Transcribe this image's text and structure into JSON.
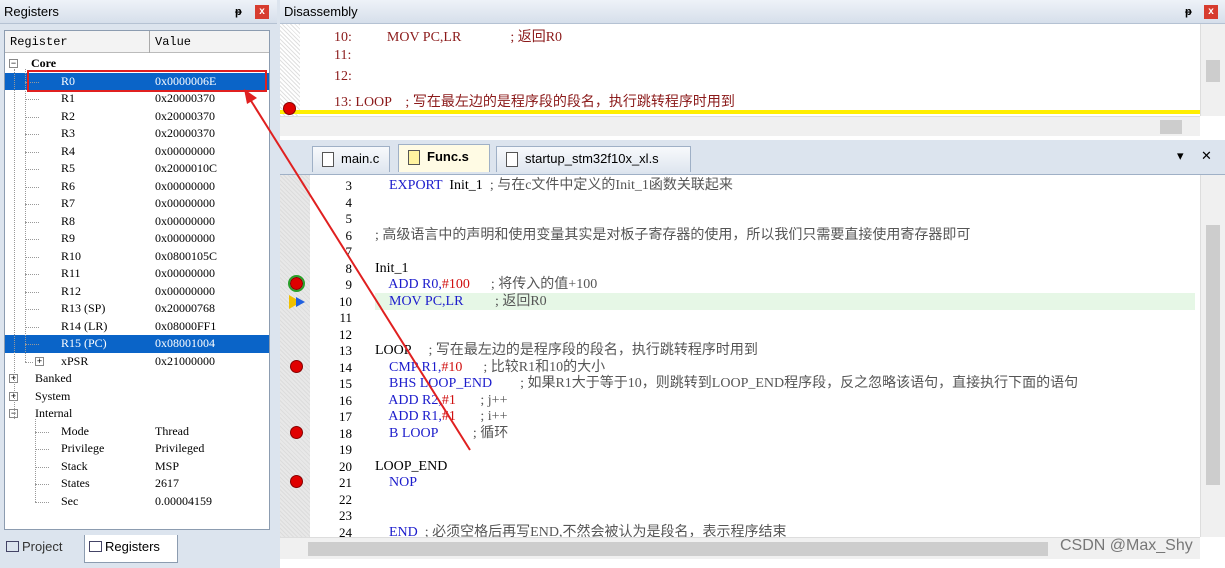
{
  "registers_panel": {
    "title": "Registers",
    "pin": "ᵽ",
    "close": "x",
    "col_register": "Register",
    "col_value": "Value",
    "groups": {
      "core": "Core",
      "banked": "Banked",
      "system": "System",
      "internal": "Internal"
    },
    "core_rows": [
      {
        "name": "R0",
        "value": "0x0000006E"
      },
      {
        "name": "R1",
        "value": "0x20000370"
      },
      {
        "name": "R2",
        "value": "0x20000370"
      },
      {
        "name": "R3",
        "value": "0x20000370"
      },
      {
        "name": "R4",
        "value": "0x00000000"
      },
      {
        "name": "R5",
        "value": "0x2000010C"
      },
      {
        "name": "R6",
        "value": "0x00000000"
      },
      {
        "name": "R7",
        "value": "0x00000000"
      },
      {
        "name": "R8",
        "value": "0x00000000"
      },
      {
        "name": "R9",
        "value": "0x00000000"
      },
      {
        "name": "R10",
        "value": "0x0800105C"
      },
      {
        "name": "R11",
        "value": "0x00000000"
      },
      {
        "name": "R12",
        "value": "0x00000000"
      },
      {
        "name": "R13 (SP)",
        "value": "0x20000768"
      },
      {
        "name": "R14 (LR)",
        "value": "0x08000FF1"
      },
      {
        "name": "R15 (PC)",
        "value": "0x08001004"
      },
      {
        "name": "xPSR",
        "value": "0x21000000"
      }
    ],
    "internal_rows": [
      {
        "name": "Mode",
        "value": "Thread"
      },
      {
        "name": "Privilege",
        "value": "Privileged"
      },
      {
        "name": "Stack",
        "value": "MSP"
      },
      {
        "name": "States",
        "value": "2617"
      },
      {
        "name": "Sec",
        "value": "0.00004159"
      }
    ],
    "tabs": {
      "project": "Project",
      "registers": "Registers"
    }
  },
  "disassembly": {
    "title": "Disassembly",
    "pin": "ᵽ",
    "close": "x",
    "lines": [
      "    10:          MOV PC,LR              ; 返回R0",
      "    11:",
      "    12:",
      "    13: LOOP    ; 写在最左边的是程序段的段名，执行跳转程序时用到"
    ]
  },
  "editor": {
    "tabs": [
      "main.c",
      "Func.s",
      "startup_stm32f10x_xl.s"
    ],
    "menu_glyph": "▾",
    "close_glyph": "✕",
    "lines": [
      {
        "n": "3",
        "code": [
          [
            "kw",
            "    EXPORT  "
          ],
          [
            "",
            "Init_1  "
          ],
          [
            "cm",
            "; 与在c文件中定义的Init_1函数关联起来"
          ]
        ]
      },
      {
        "n": "4",
        "code": []
      },
      {
        "n": "5",
        "code": []
      },
      {
        "n": "6",
        "code": [
          [
            "cm",
            "; 高级语言中的声明和使用变量其实是对板子寄存器的使用，所以我们只需要直接使用寄存器即可"
          ]
        ]
      },
      {
        "n": "7",
        "code": []
      },
      {
        "n": "8",
        "code": [
          [
            "",
            "Init_1"
          ]
        ]
      },
      {
        "n": "9",
        "code": [
          [
            "kw",
            "    ADD R0,"
          ],
          [
            "num",
            "#100"
          ],
          [
            "cm",
            "      ; 将传入的值+100"
          ]
        ]
      },
      {
        "n": "10",
        "code": [
          [
            "kw",
            "    MOV PC,LR"
          ],
          [
            "cm",
            "         ; 返回R0"
          ]
        ]
      },
      {
        "n": "11",
        "code": []
      },
      {
        "n": "12",
        "code": []
      },
      {
        "n": "13",
        "code": [
          [
            "",
            "LOOP     "
          ],
          [
            "cm",
            "; 写在最左边的是程序段的段名，执行跳转程序时用到"
          ]
        ]
      },
      {
        "n": "14",
        "code": [
          [
            "kw",
            "    CMP R1,"
          ],
          [
            "num",
            "#10"
          ],
          [
            "cm",
            "      ; 比较R1和10的大小"
          ]
        ]
      },
      {
        "n": "15",
        "code": [
          [
            "kw",
            "    BHS LOOP_END"
          ],
          [
            "cm",
            "        ; 如果R1大于等于10，则跳转到LOOP_END程序段，反之忽略该语句，直接执行下面的语句"
          ]
        ]
      },
      {
        "n": "16",
        "code": [
          [
            "kw",
            "    ADD R2,"
          ],
          [
            "num",
            "#1"
          ],
          [
            "cm",
            "       ; j++"
          ]
        ]
      },
      {
        "n": "17",
        "code": [
          [
            "kw",
            "    ADD R1,"
          ],
          [
            "num",
            "#1"
          ],
          [
            "cm",
            "       ; i++"
          ]
        ]
      },
      {
        "n": "18",
        "code": [
          [
            "kw",
            "    B LOOP"
          ],
          [
            "cm",
            "          ; 循环"
          ]
        ]
      },
      {
        "n": "19",
        "code": []
      },
      {
        "n": "20",
        "code": [
          [
            "",
            "LOOP_END"
          ]
        ]
      },
      {
        "n": "21",
        "code": [
          [
            "kw",
            "    NOP"
          ]
        ]
      },
      {
        "n": "22",
        "code": []
      },
      {
        "n": "23",
        "code": []
      },
      {
        "n": "24",
        "code": [
          [
            "kw",
            "    END  "
          ],
          [
            "cm",
            "; 必须空格后再写END,不然会被认为是段名，表示程序结束"
          ]
        ]
      }
    ]
  },
  "watermark": "CSDN @Max_Shy",
  "colors": {
    "selection": "#0a64c8",
    "highlight": "#e6f7e6",
    "annotation": "#e02020",
    "keyword": "#1c1ccc",
    "number": "#d01010"
  }
}
